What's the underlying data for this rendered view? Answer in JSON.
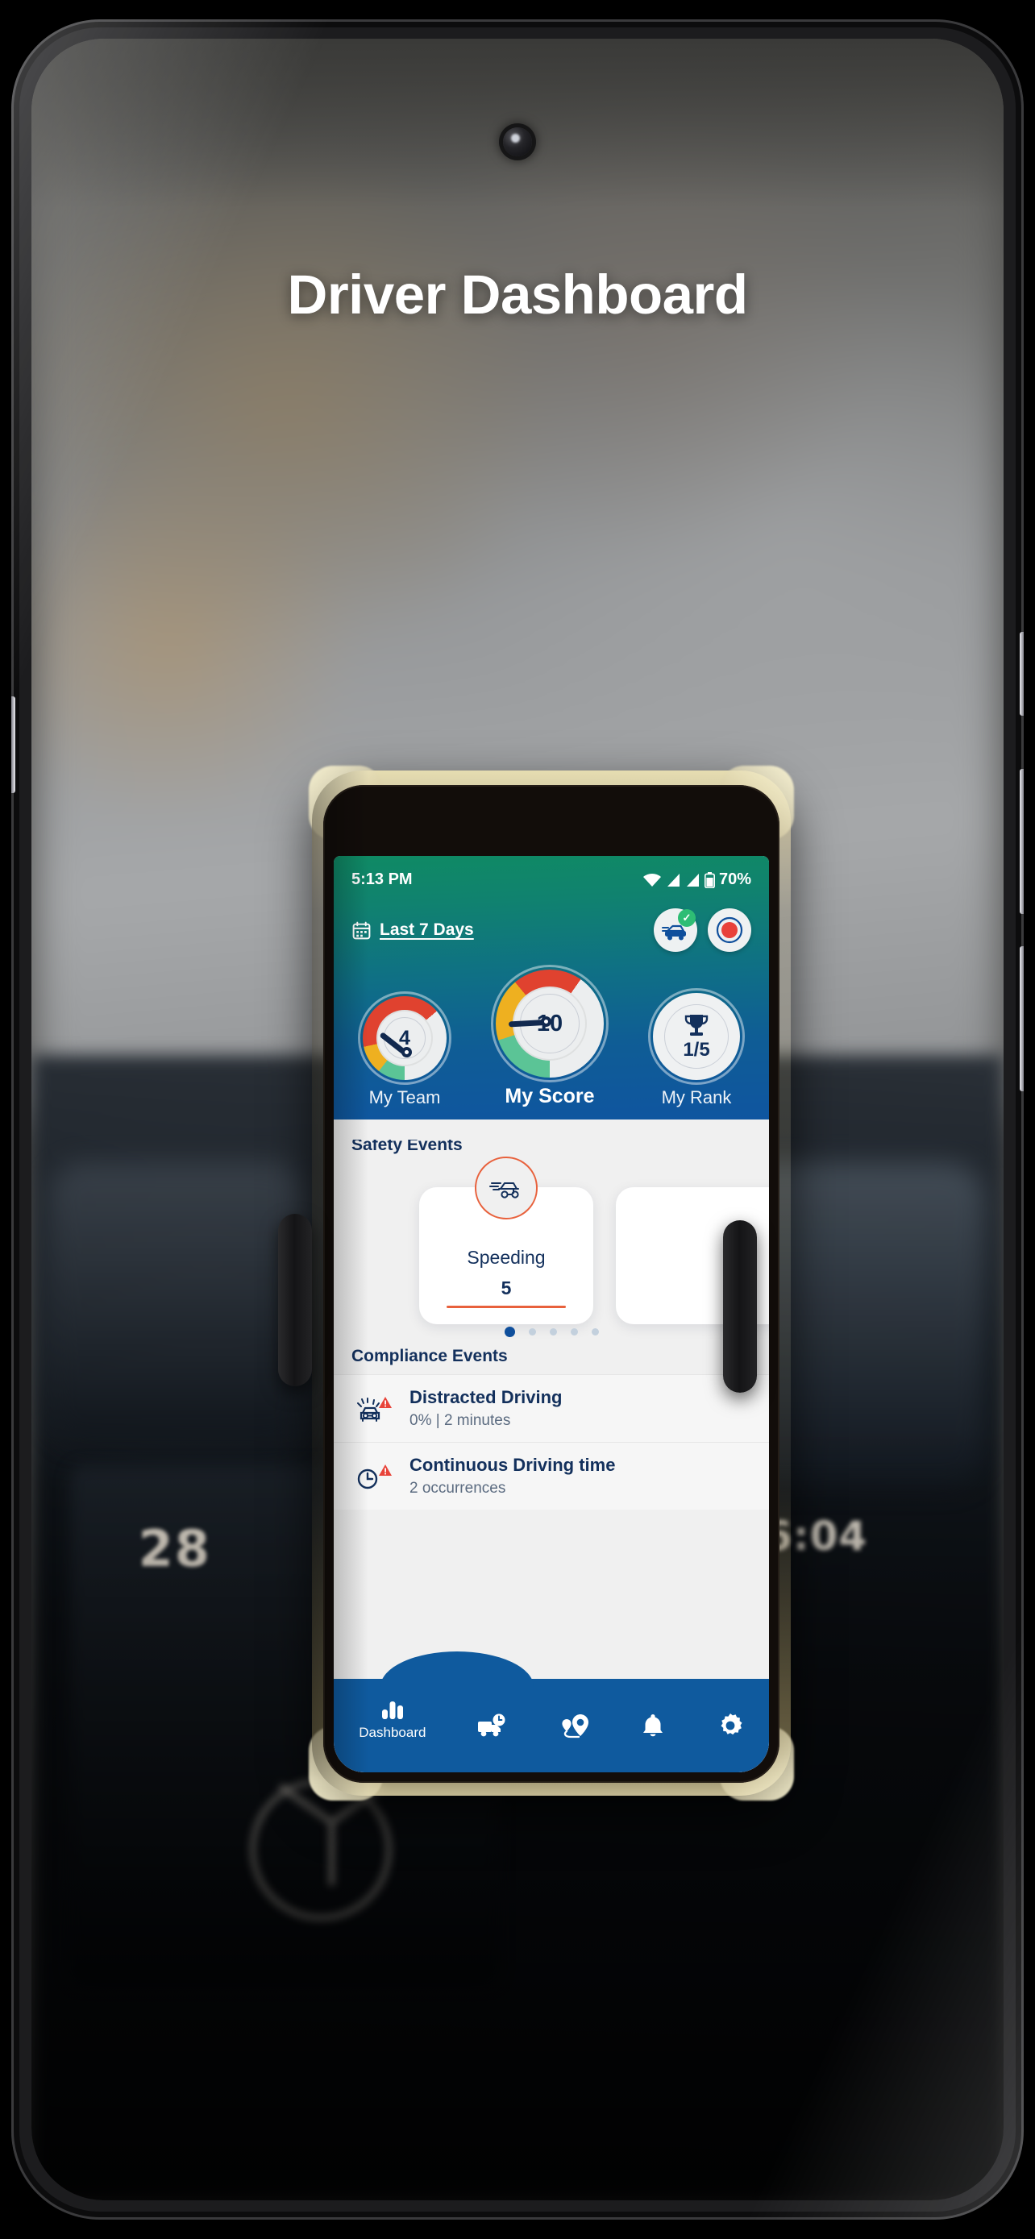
{
  "hero": {
    "title": "Driver Dashboard"
  },
  "phone_status_bar": {
    "time": "5:13 PM",
    "battery_percent": "70%",
    "wifi_icon": "wifi-icon",
    "signal1_icon": "signal-bars-icon",
    "signal2_icon": "signal-bars-icon",
    "battery_icon": "battery-icon"
  },
  "app_header": {
    "date_range": {
      "label": "Last 7 Days",
      "calendar_icon": "calendar-icon"
    },
    "actions": [
      {
        "name": "vehicle-status-button",
        "icon": "car-check-icon",
        "badge": "✓"
      },
      {
        "name": "record-trip-button",
        "icon": "record-dot-icon"
      }
    ],
    "gauges": [
      {
        "label": "My Team",
        "value": "4",
        "type": "gauge"
      },
      {
        "label": "My Score",
        "value": "10",
        "type": "gauge",
        "primary": true
      },
      {
        "label": "My Rank",
        "value": "1/5",
        "type": "trophy",
        "icon": "trophy-icon"
      }
    ]
  },
  "safety": {
    "section_title": "Safety Events",
    "cards": [
      {
        "name": "Speeding",
        "value": "5",
        "icon": "speeding-car-icon"
      },
      {
        "name": "",
        "value": "",
        "icon": ""
      }
    ],
    "pagination": {
      "total": 5,
      "active_index": 0
    }
  },
  "compliance": {
    "section_title": "Compliance Events",
    "rows": [
      {
        "title": "Distracted Driving",
        "subtitle": "0% | 2 minutes",
        "icon": "distracted-driving-icon",
        "alert_icon": "warning-triangle-icon"
      },
      {
        "title": "Continuous Driving time",
        "subtitle": "2 occurrences",
        "icon": "clock-driving-icon",
        "alert_icon": "warning-triangle-icon"
      }
    ]
  },
  "bottom_nav": [
    {
      "label": "Dashboard",
      "icon": "bar-chart-icon",
      "active": true
    },
    {
      "label": "",
      "icon": "truck-clock-icon",
      "active": false
    },
    {
      "label": "",
      "icon": "route-pin-icon",
      "active": false
    },
    {
      "label": "",
      "icon": "bell-icon",
      "active": false
    },
    {
      "label": "",
      "icon": "gear-icon",
      "active": false
    }
  ],
  "car_dashboard": {
    "speed_or_temp": "28",
    "clock": "16:04"
  },
  "colors": {
    "header_green": "#0f8a64",
    "header_blue": "#0f55a0",
    "nav_blue": "#0f5a9e",
    "accent_orange": "#e8613c",
    "navy_text": "#13305c",
    "gauge_green": "#5bc496",
    "gauge_yellow": "#eeb020",
    "gauge_red": "#e0422f",
    "alert_red": "#e8443a",
    "check_green": "#2ebd74"
  }
}
